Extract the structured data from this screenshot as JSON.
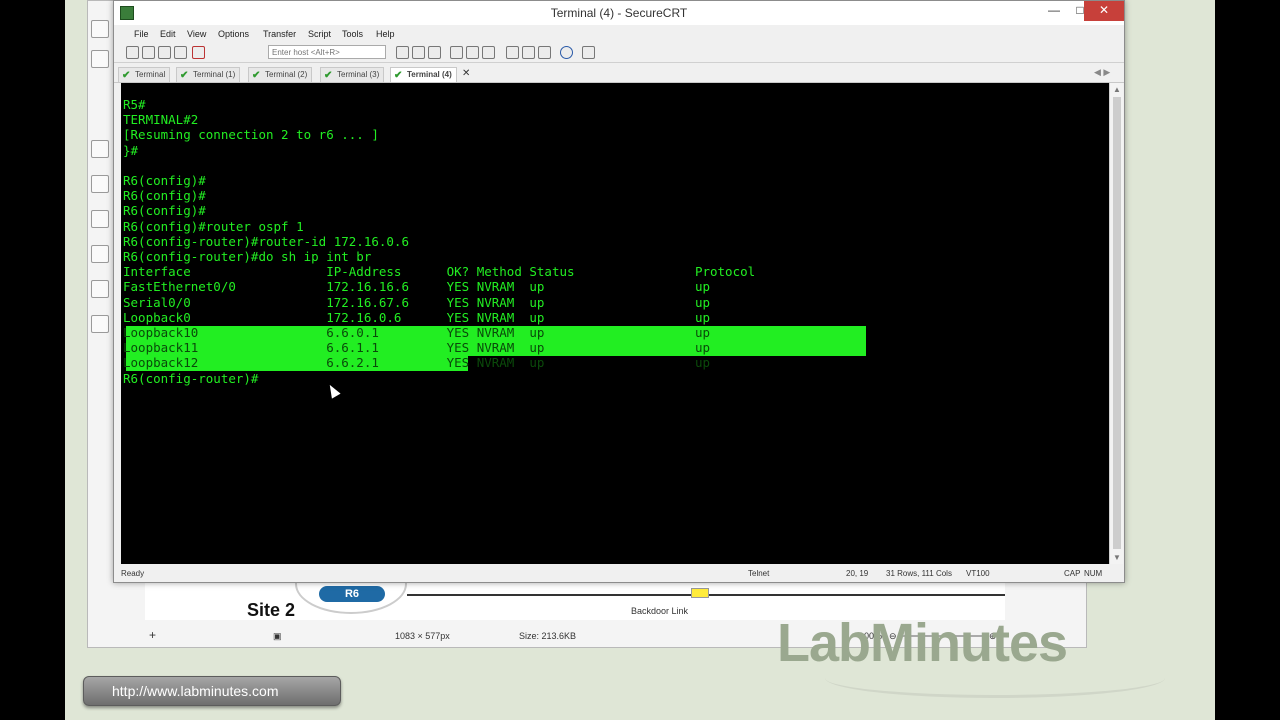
{
  "window": {
    "title": "Terminal (4) - SecureCRT",
    "min_label": "—",
    "max_label": "□",
    "close_label": "✕"
  },
  "menu": [
    "File",
    "Edit",
    "View",
    "Options",
    "Transfer",
    "Script",
    "Tools",
    "Help"
  ],
  "toolbar": {
    "host_placeholder": "Enter host <Alt+R>"
  },
  "tabs": [
    {
      "label": "Terminal",
      "active": false
    },
    {
      "label": "Terminal (1)",
      "active": false
    },
    {
      "label": "Terminal (2)",
      "active": false
    },
    {
      "label": "Terminal (3)",
      "active": false
    },
    {
      "label": "Terminal (4)",
      "active": true
    }
  ],
  "tab_close": "✕",
  "tab_nav": "◀ ▶",
  "terminal": {
    "lines": [
      "R5#",
      "TERMINAL#2",
      "[Resuming connection 2 to r6 ... ]",
      "}#",
      "",
      "R6(config)#",
      "R6(config)#",
      "R6(config)#",
      "R6(config)#router ospf 1",
      "R6(config-router)#router-id 172.16.0.6",
      "R6(config-router)#do sh ip int br",
      "Interface                  IP-Address      OK? Method Status                Protocol",
      "FastEthernet0/0            172.16.16.6     YES NVRAM  up                    up",
      "Serial0/0                  172.16.67.6     YES NVRAM  up                    up",
      "Loopback0                  172.16.0.6      YES NVRAM  up                    up",
      "Loopback10                 6.6.0.1         YES NVRAM  up                    up",
      "Loopback11                 6.6.1.1         YES NVRAM  up                    up",
      "Loopback12                 6.6.2.1         YES NVRAM  up                    up",
      "R6(config-router)#"
    ],
    "text_color": "#22ee22",
    "background_color": "#000000"
  },
  "status": {
    "ready": "Ready",
    "protocol": "Telnet",
    "cursor_pos": "20, 19",
    "size": "31 Rows, 111 Cols",
    "emulation": "VT100",
    "caps": "CAP",
    "num": "NUM"
  },
  "background_viewer": {
    "device_label": "R6",
    "site_label": "Site 2",
    "link_label": "Backdoor Link",
    "image_dims": "1083 × 577px",
    "image_size": "Size: 213.6KB",
    "zoom": "100%"
  },
  "branding": {
    "url": "http://www.labminutes.com",
    "logo_text": "LabMinutes"
  }
}
